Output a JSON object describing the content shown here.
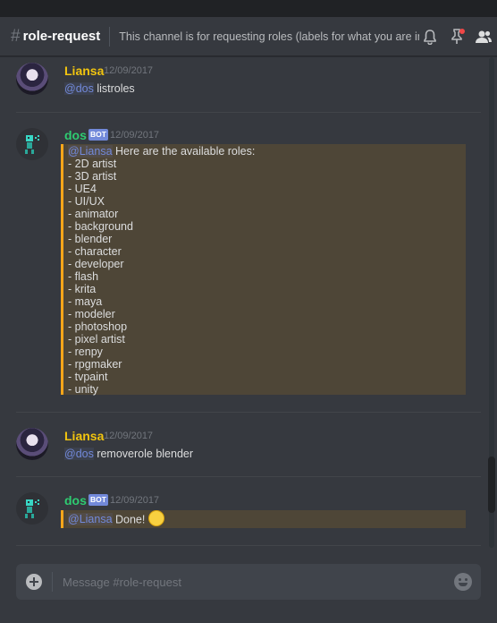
{
  "channel": {
    "hash": "#",
    "name": "role-request",
    "topic": "This channel is for requesting roles (labels for what you are in.."
  },
  "header_icons": [
    "bell-icon",
    "pin-icon",
    "members-icon"
  ],
  "messages": [
    {
      "author": "Liansa",
      "timestamp": "12/09/2017",
      "mention": "@dos",
      "text": " listroles"
    },
    {
      "author": "dos",
      "bot_tag": "BOT",
      "timestamp": "12/09/2017",
      "mention": "@Liansa",
      "intro": " Here are the available roles:",
      "roles": [
        "- 2D artist",
        "- 3D artist",
        "- UE4",
        "- UI/UX",
        "- animator",
        "- background",
        "- blender",
        "- character",
        "- developer",
        "- flash",
        "- krita",
        "- maya",
        "- modeler",
        "- photoshop",
        "- pixel artist",
        "- renpy",
        "- rpgmaker",
        "- tvpaint",
        "- unity"
      ]
    },
    {
      "author": "Liansa",
      "timestamp": "12/09/2017",
      "mention": "@dos",
      "text": " removerole blender"
    },
    {
      "author": "dos",
      "bot_tag": "BOT",
      "timestamp": "12/09/2017",
      "mention": "@Liansa",
      "text": " Done! ",
      "emoji": "smiley-emoji"
    }
  ],
  "composer": {
    "placeholder": "Message #role-request"
  },
  "colors": {
    "background": "#36393f",
    "liansa_name": "#f1c40f",
    "dos_name": "#2ecc71",
    "mention": "#7289da",
    "highlight_border": "#faa61a"
  }
}
